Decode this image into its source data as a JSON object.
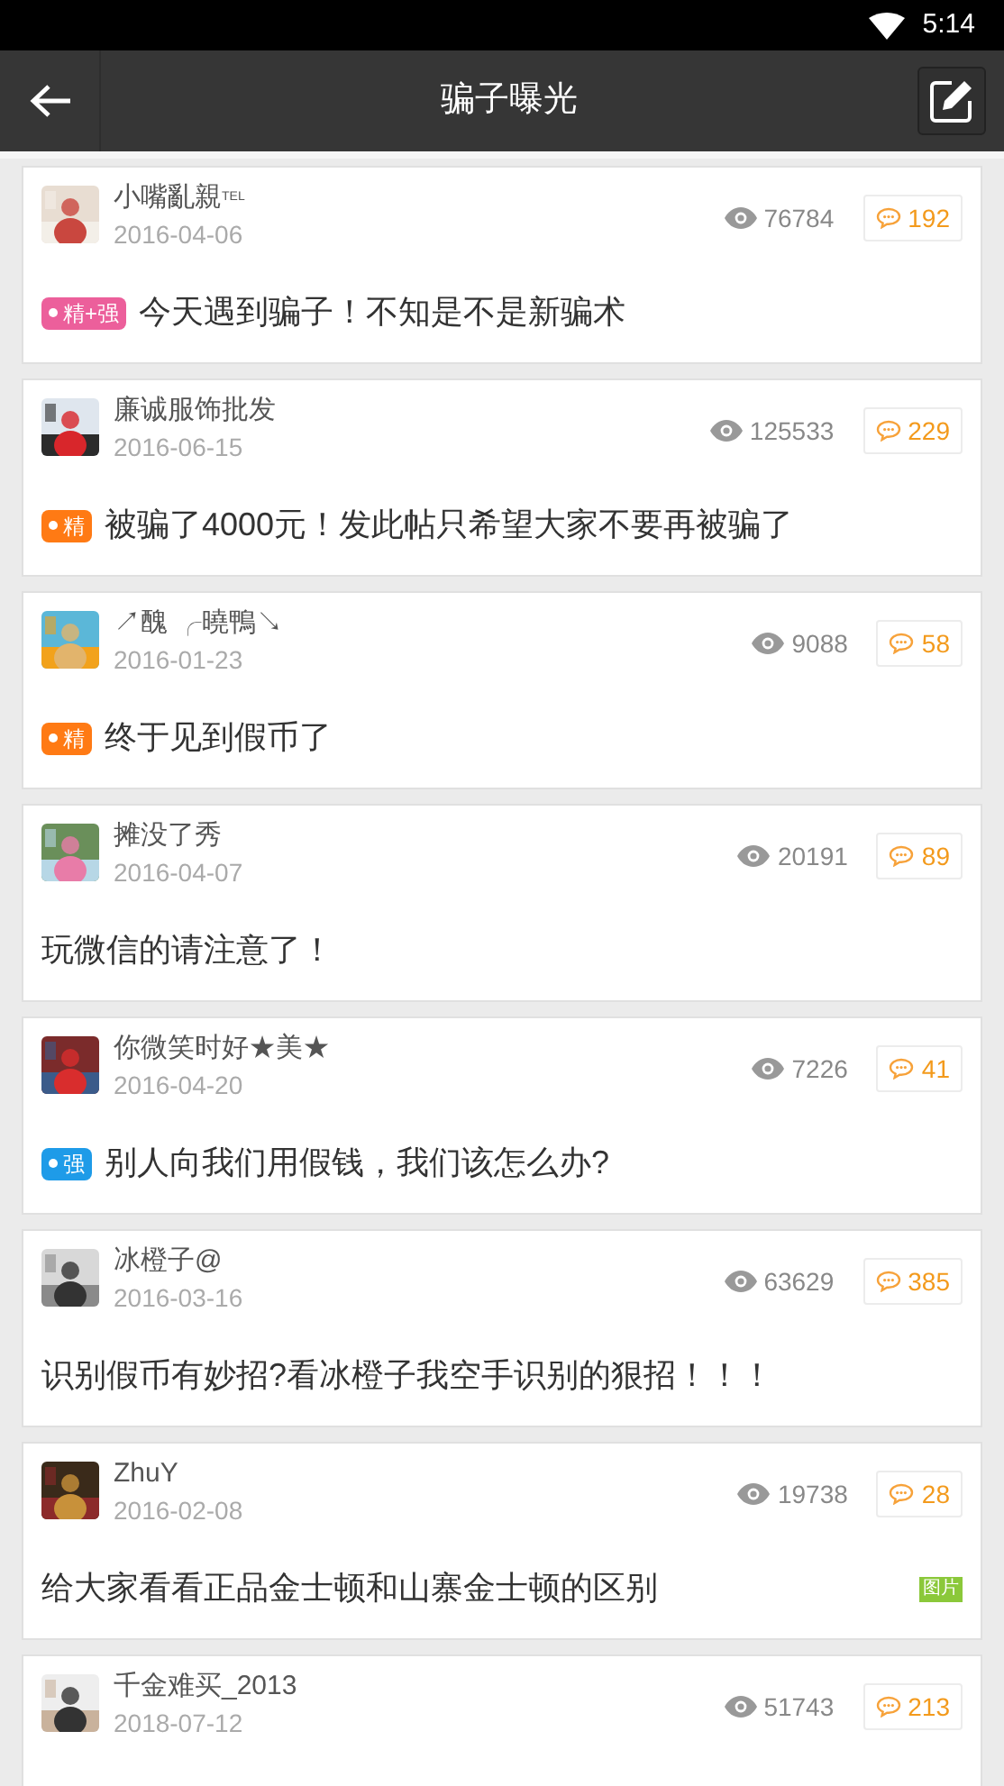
{
  "status_bar": {
    "time": "5:14"
  },
  "toolbar": {
    "title": "骗子曝光"
  },
  "posts": [
    {
      "author": "小嘴亂親$^{TEL}$",
      "date": "2016-04-06",
      "views": "76784",
      "comments": "192",
      "badge": {
        "label": "精+强",
        "color": "#ec5f9b"
      },
      "title": "今天遇到骗子！不知是不是新骗术"
    },
    {
      "author": "廉诚服饰批发",
      "date": "2016-06-15",
      "views": "125533",
      "comments": "229",
      "badge": {
        "label": "精",
        "color": "#ff7a14"
      },
      "title": "被骗了4000元！发此帖只希望大家不要再被骗了"
    },
    {
      "author": "↗醜 ╭曉鴨↘",
      "date": "2016-01-23",
      "views": "9088",
      "comments": "58",
      "badge": {
        "label": "精",
        "color": "#ff7a14"
      },
      "title": "终于见到假币了"
    },
    {
      "author": "摊没了秀",
      "date": "2016-04-07",
      "views": "20191",
      "comments": "89",
      "title": "玩微信的请注意了！"
    },
    {
      "author": "你微笑时好★美★",
      "date": "2016-04-20",
      "views": "7226",
      "comments": "41",
      "badge": {
        "label": "强",
        "color": "#1e9be8"
      },
      "title": "别人向我们用假钱，我们该怎么办?"
    },
    {
      "author": "冰橙子@",
      "date": "2016-03-16",
      "views": "63629",
      "comments": "385",
      "title": "识别假币有妙招?看冰橙子我空手识别的狠招！！！"
    },
    {
      "author": "ZhuY",
      "date": "2016-02-08",
      "views": "19738",
      "comments": "28",
      "title": "给大家看看正品金士顿和山寨金士顿的区别",
      "tag": "图片"
    },
    {
      "author": "千金难买_2013",
      "date": "2018-07-12",
      "views": "51743",
      "comments": "213"
    }
  ]
}
